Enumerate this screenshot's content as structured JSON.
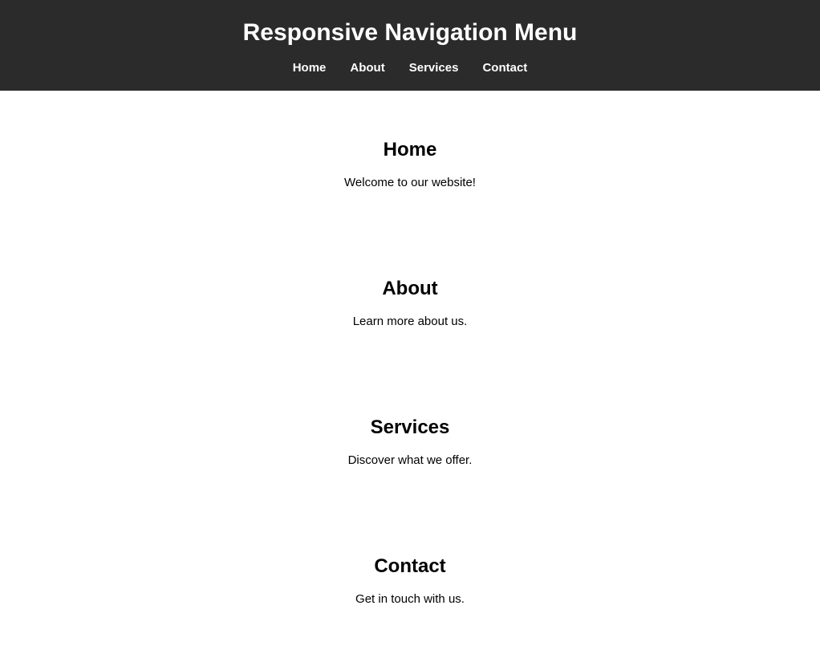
{
  "header": {
    "title": "Responsive Navigation Menu"
  },
  "nav": {
    "items": [
      {
        "label": "Home"
      },
      {
        "label": "About"
      },
      {
        "label": "Services"
      },
      {
        "label": "Contact"
      }
    ]
  },
  "sections": [
    {
      "heading": "Home",
      "text": "Welcome to our website!"
    },
    {
      "heading": "About",
      "text": "Learn more about us."
    },
    {
      "heading": "Services",
      "text": "Discover what we offer."
    },
    {
      "heading": "Contact",
      "text": "Get in touch with us."
    }
  ]
}
